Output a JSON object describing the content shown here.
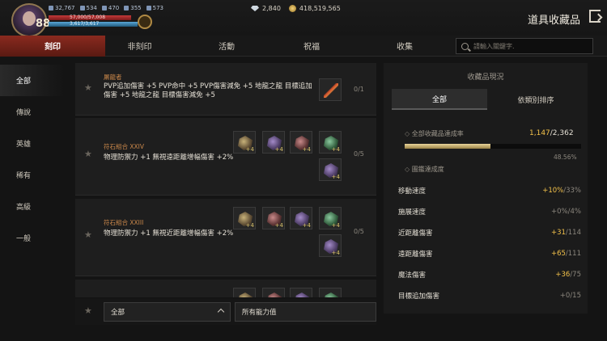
{
  "header": {
    "level": "88",
    "stats": [
      "32,767",
      "534",
      "470",
      "355",
      "573"
    ],
    "hp_text": "57,000/57,008",
    "mp_text": "3,617/3,617",
    "crystals": "2,840",
    "gold": "418,519,565",
    "title": "道具收藏品"
  },
  "tabs": [
    "刻印",
    "非刻印",
    "活動",
    "祝福",
    "收集"
  ],
  "search": {
    "placeholder": "請輸入關鍵字."
  },
  "sidebar": [
    "全部",
    "傳說",
    "英雄",
    "稀有",
    "高級",
    "一般"
  ],
  "list": [
    {
      "name": "屠龍者",
      "desc": "PVP追加傷害 +5 PVP命中 +5 PVP傷害減免 +5 地龍之龍 目標追加傷害 +5 地龍之龍 目標傷害減免 +5",
      "count": "0/1"
    },
    {
      "name": "符石組合 XXIV",
      "desc": "物理防禦力 +1 無視遠距離增幅傷害 +2%",
      "count": "0/5"
    },
    {
      "name": "符石組合 XXIII",
      "desc": "物理防禦力 +1 無視近距離增幅傷害 +2%",
      "count": "0/5"
    }
  ],
  "filter": {
    "grade": "全部",
    "ability": "所有能力值"
  },
  "panel": {
    "title": "收藏品現況",
    "tab_all": "全部",
    "tab_sort": "依類別排序",
    "section_total": "全部收藏品達成率",
    "total_cur": "1,147",
    "total_max": "/2,362",
    "total_percent": "48.56%",
    "progress": 0.4856,
    "section_stats": "圖鑑達成度",
    "stats": [
      {
        "label": "移動速度",
        "cur": "+10%",
        "max": "/33%"
      },
      {
        "label": "施展速度",
        "cur": "+0%",
        "max": "/4%"
      },
      {
        "label": "近距離傷害",
        "cur": "+31",
        "max": "/114"
      },
      {
        "label": "遠距離傷害",
        "cur": "+65",
        "max": "/111"
      },
      {
        "label": "魔法傷害",
        "cur": "+36",
        "max": "/75"
      },
      {
        "label": "目標追加傷害",
        "cur": "+0",
        "max": "/15"
      }
    ]
  },
  "colors": {
    "accent_red": "#8a2a1f",
    "gold": "#f2c14a"
  }
}
